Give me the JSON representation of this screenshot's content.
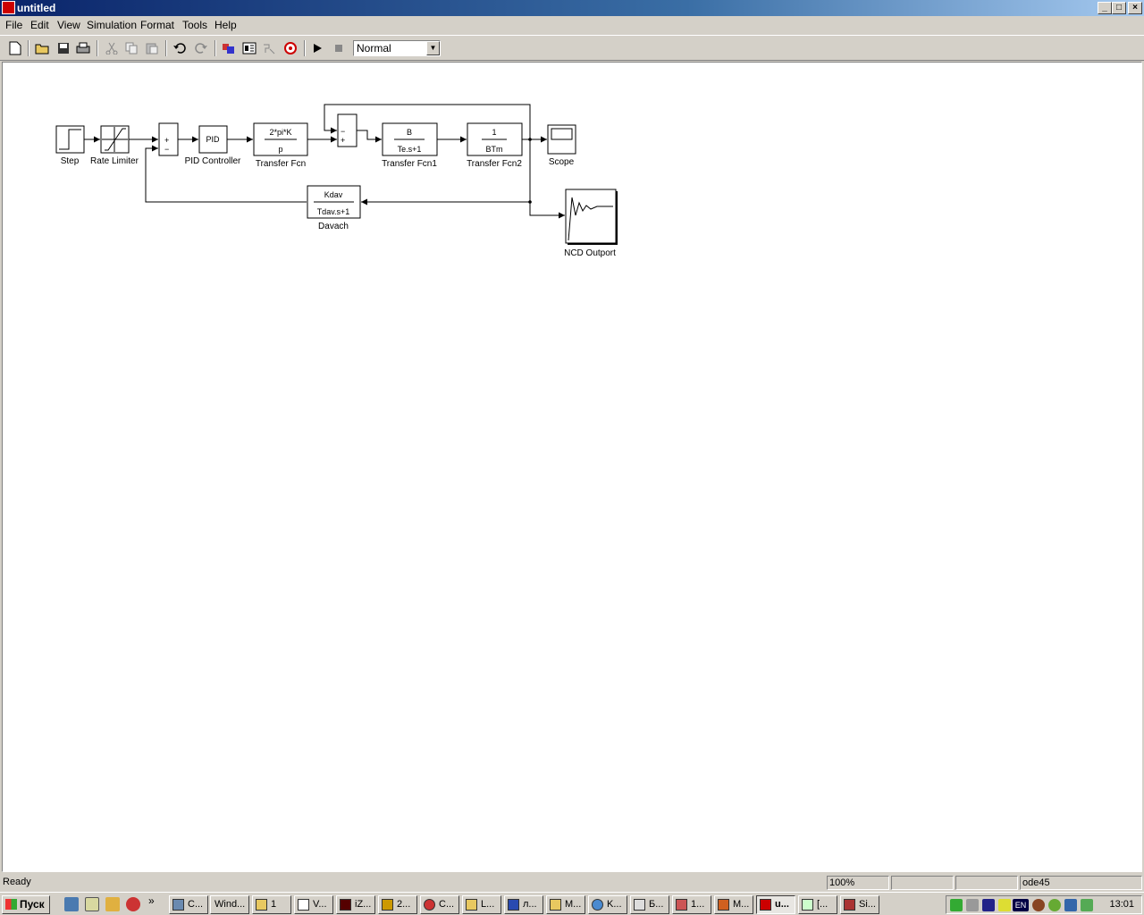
{
  "window": {
    "title": "untitled"
  },
  "menu": [
    "File",
    "Edit",
    "View",
    "Simulation",
    "Format",
    "Tools",
    "Help"
  ],
  "toolbar": {
    "mode": "Normal"
  },
  "blocks": {
    "step": "Step",
    "rate_limiter": "Rate Limiter",
    "pid_inner": "PID",
    "pid": "PID Controller",
    "tf_num": "2*pi*K",
    "tf_den": "p",
    "tf": "Transfer Fcn",
    "tf1_num": "B",
    "tf1_den": "Te.s+1",
    "tf1": "Transfer Fcn1",
    "tf2_num": "1",
    "tf2_den": "BTm",
    "tf2": "Transfer Fcn2",
    "scope": "Scope",
    "davach_num": "Kdav",
    "davach_den": "Tdav.s+1",
    "davach": "Davach",
    "ncd": "NCD Outport",
    "sum1_plus": "+",
    "sum1_minus": "−",
    "sum2_minus": "−",
    "sum2_plus": "+"
  },
  "status": {
    "text": "Ready",
    "zoom": "100%",
    "solver": "ode45"
  },
  "taskbar": {
    "start": "Пуск",
    "more": "»",
    "buttons": [
      "C...",
      "Wind...",
      "1",
      "V...",
      "iZ...",
      "2...",
      "C...",
      "L...",
      "л...",
      "M...",
      "K...",
      "Б...",
      "1...",
      "M...",
      "u...",
      "[...",
      "Si..."
    ],
    "tray_lang": "EN",
    "clock": "13:01"
  }
}
